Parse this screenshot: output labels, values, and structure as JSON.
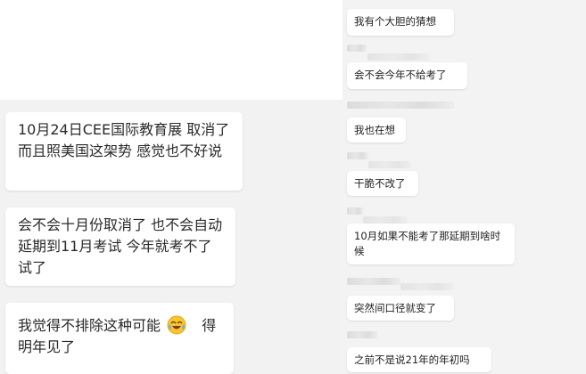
{
  "left_messages": [
    {
      "text": "10月24日CEE国际教育展 取消了 而且照美国这架势 感觉也不好说"
    },
    {
      "text": "会不会十月份取消了 也不会自动延期到11月考试 今年就考不了试了"
    },
    {
      "text_before": "我觉得不排除这种可能",
      "text_after": "得明年见了",
      "emoji": "laughing-tears-emoji"
    }
  ],
  "right_messages": [
    {
      "text": "我有个大胆的猜想"
    },
    {
      "text": "会不会今年不给考了"
    },
    {
      "text": "我也在想"
    },
    {
      "text": "干脆不改了"
    },
    {
      "text": "10月如果不能考了那延期到啥时候"
    },
    {
      "text": "突然间口径就变了"
    },
    {
      "text": "之前不是说21年的年初吗"
    }
  ]
}
